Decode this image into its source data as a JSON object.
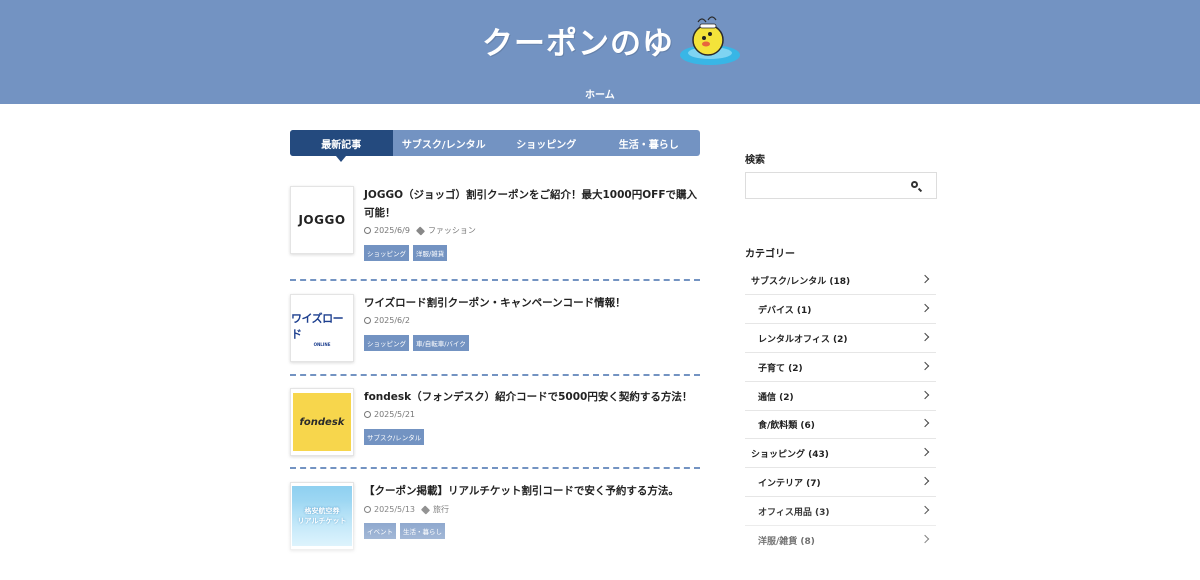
{
  "site": {
    "logo_text": "クーポンのゆ",
    "nav": [
      {
        "label": "ホーム"
      }
    ]
  },
  "tabs": [
    {
      "label": "最新記事",
      "active": true
    },
    {
      "label": "サブスク/レンタル",
      "active": false
    },
    {
      "label": "ショッピング",
      "active": false
    },
    {
      "label": "生活・暮らし",
      "active": false
    }
  ],
  "articles": [
    {
      "title": "JOGGO（ジョッゴ）割引クーポンをご紹介！最大1000円OFFで購入可能！",
      "date": "2025/6/9",
      "tag_label": "ファッション",
      "tags": [
        "ショッピング",
        "洋服/雑貨"
      ],
      "thumb_text": "JOGGO"
    },
    {
      "title": "ワイズロード割引クーポン・キャンペーンコード情報！",
      "date": "2025/6/2",
      "tag_label": "",
      "tags": [
        "ショッピング",
        "車/自転車/バイク"
      ],
      "thumb_text": "ワイズロード",
      "thumb_sub": "ONLINE"
    },
    {
      "title": "fondesk（フォンデスク）紹介コードで5000円安く契約する方法！",
      "date": "2025/5/21",
      "tag_label": "",
      "tags": [
        "サブスク/レンタル"
      ],
      "thumb_text": "fondesk"
    },
    {
      "title": "【クーポン掲載】リアルチケット割引コードで安く予約する方法。",
      "date": "2025/5/13",
      "tag_label": "旅行",
      "tags": [
        "イベント",
        "生活・暮らし"
      ],
      "thumb_text": "格安航空券",
      "thumb_sub": "リアルチケット"
    }
  ],
  "sidebar": {
    "search_heading": "検索",
    "search_placeholder": "",
    "category_heading": "カテゴリー",
    "categories": [
      {
        "label": "サブスク/レンタル (18)",
        "level": 0
      },
      {
        "label": "デバイス (1)",
        "level": 1
      },
      {
        "label": "レンタルオフィス (2)",
        "level": 1
      },
      {
        "label": "子育て (2)",
        "level": 1
      },
      {
        "label": "通信 (2)",
        "level": 1
      },
      {
        "label": "食/飲料類 (6)",
        "level": 1
      },
      {
        "label": "ショッピング (43)",
        "level": 0
      },
      {
        "label": "インテリア (7)",
        "level": 1
      },
      {
        "label": "オフィス用品 (3)",
        "level": 1
      },
      {
        "label": "洋服/雑貨 (8)",
        "level": 1
      }
    ]
  },
  "colors": {
    "header_bg": "#7393c2",
    "tab_active": "#244a7e",
    "tag_bg": "#7393c2"
  }
}
